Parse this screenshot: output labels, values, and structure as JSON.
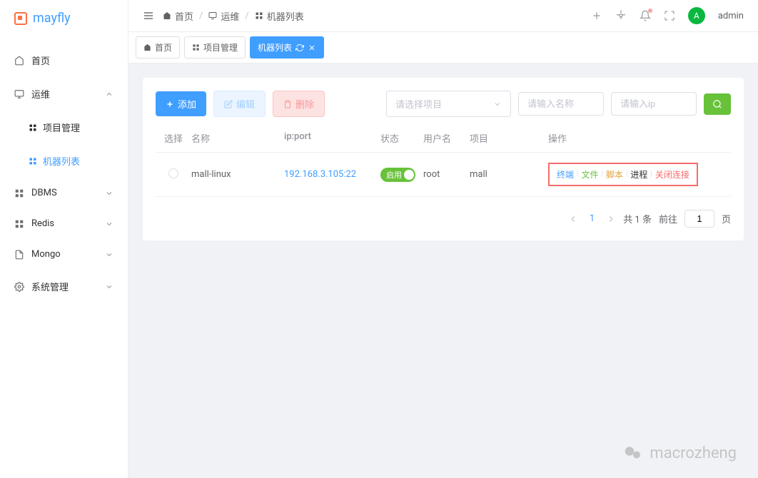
{
  "app": {
    "name": "mayfly"
  },
  "header": {
    "breadcrumb": [
      {
        "label": "首页"
      },
      {
        "label": "运维"
      },
      {
        "label": "机器列表"
      }
    ],
    "user": {
      "initial": "A",
      "name": "admin"
    }
  },
  "sidebar": {
    "items": [
      {
        "label": "首页",
        "type": "item"
      },
      {
        "label": "运维",
        "type": "group",
        "expanded": true,
        "children": [
          {
            "label": "项目管理"
          },
          {
            "label": "机器列表",
            "active": true
          }
        ]
      },
      {
        "label": "DBMS",
        "type": "group"
      },
      {
        "label": "Redis",
        "type": "group"
      },
      {
        "label": "Mongo",
        "type": "group"
      },
      {
        "label": "系统管理",
        "type": "group"
      }
    ]
  },
  "tabs": [
    {
      "label": "首页"
    },
    {
      "label": "项目管理"
    },
    {
      "label": "机器列表",
      "active": true
    }
  ],
  "toolbar": {
    "add": "添加",
    "edit": "编辑",
    "delete": "删除",
    "project_placeholder": "请选择项目",
    "name_placeholder": "请输入名称",
    "ip_placeholder": "请输入ip"
  },
  "table": {
    "headers": {
      "select": "选择",
      "name": "名称",
      "ip": "ip:port",
      "status": "状态",
      "user": "用户名",
      "project": "项目",
      "action": "操作"
    },
    "rows": [
      {
        "name": "mall-linux",
        "ip": "192.168.3.105:22",
        "status": "启用",
        "user": "root",
        "project": "mall",
        "actions": {
          "terminal": "终端",
          "file": "文件",
          "script": "脚本",
          "process": "进程",
          "close": "关闭连接"
        }
      }
    ]
  },
  "pagination": {
    "current": "1",
    "total_text": "共 1 条",
    "goto_label": "前往",
    "goto_value": "1",
    "page_suffix": "页"
  },
  "watermark": "macrozheng"
}
